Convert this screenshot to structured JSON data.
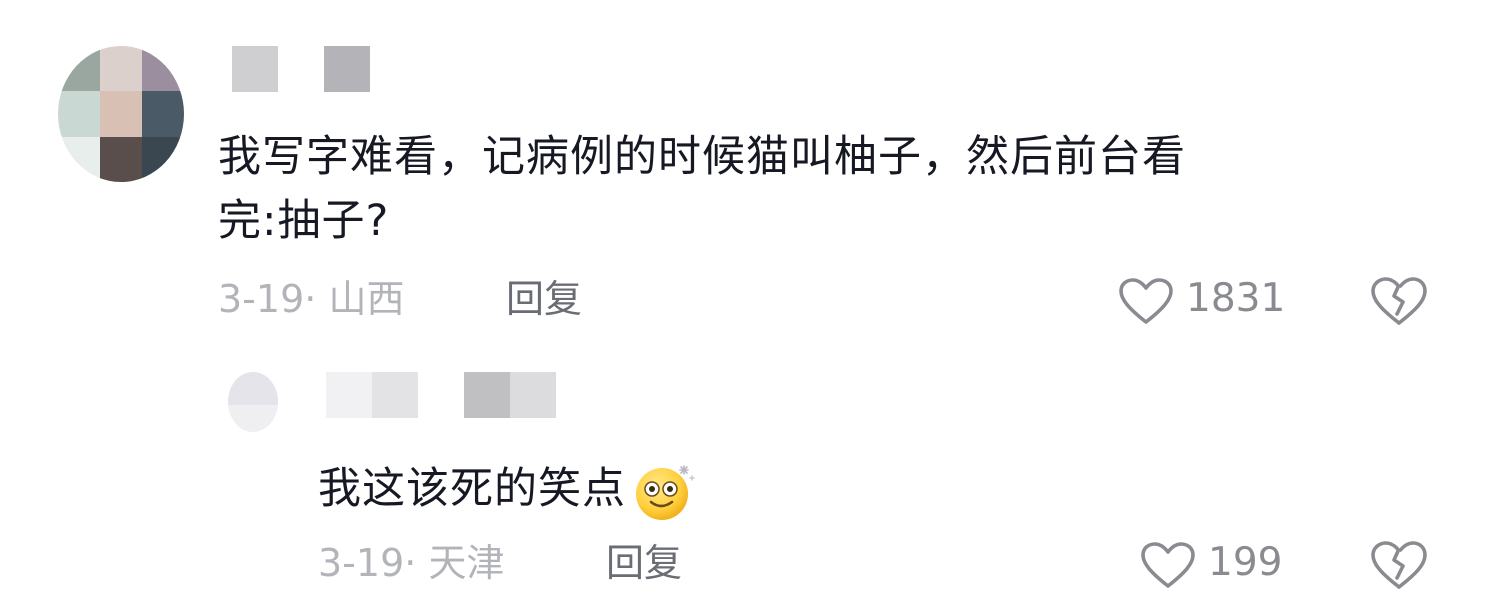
{
  "comments": [
    {
      "text": "我写字难看，记病例的时候猫叫柚子，然后前台看完:抽子?",
      "text_line1": "我写字难看，记病例的时候猫叫柚子，然后前台看",
      "text_line2": "完:抽子?",
      "date": "3-19",
      "separator": "·",
      "location": "山西",
      "reply_label": "回复",
      "likes": "1831"
    },
    {
      "text": "我这该死的笑点",
      "date": "3-19",
      "separator": "·",
      "location": "天津",
      "reply_label": "回复",
      "likes": "199"
    }
  ],
  "icons": {
    "like": "heart-outline-icon",
    "dislike": "broken-heart-icon",
    "emoji": "dizzy-smile-emoji-icon"
  },
  "colors": {
    "text": "#161823",
    "meta": "#b3b4b9",
    "reply": "#6b6d75",
    "icon": "#8a8b91"
  }
}
